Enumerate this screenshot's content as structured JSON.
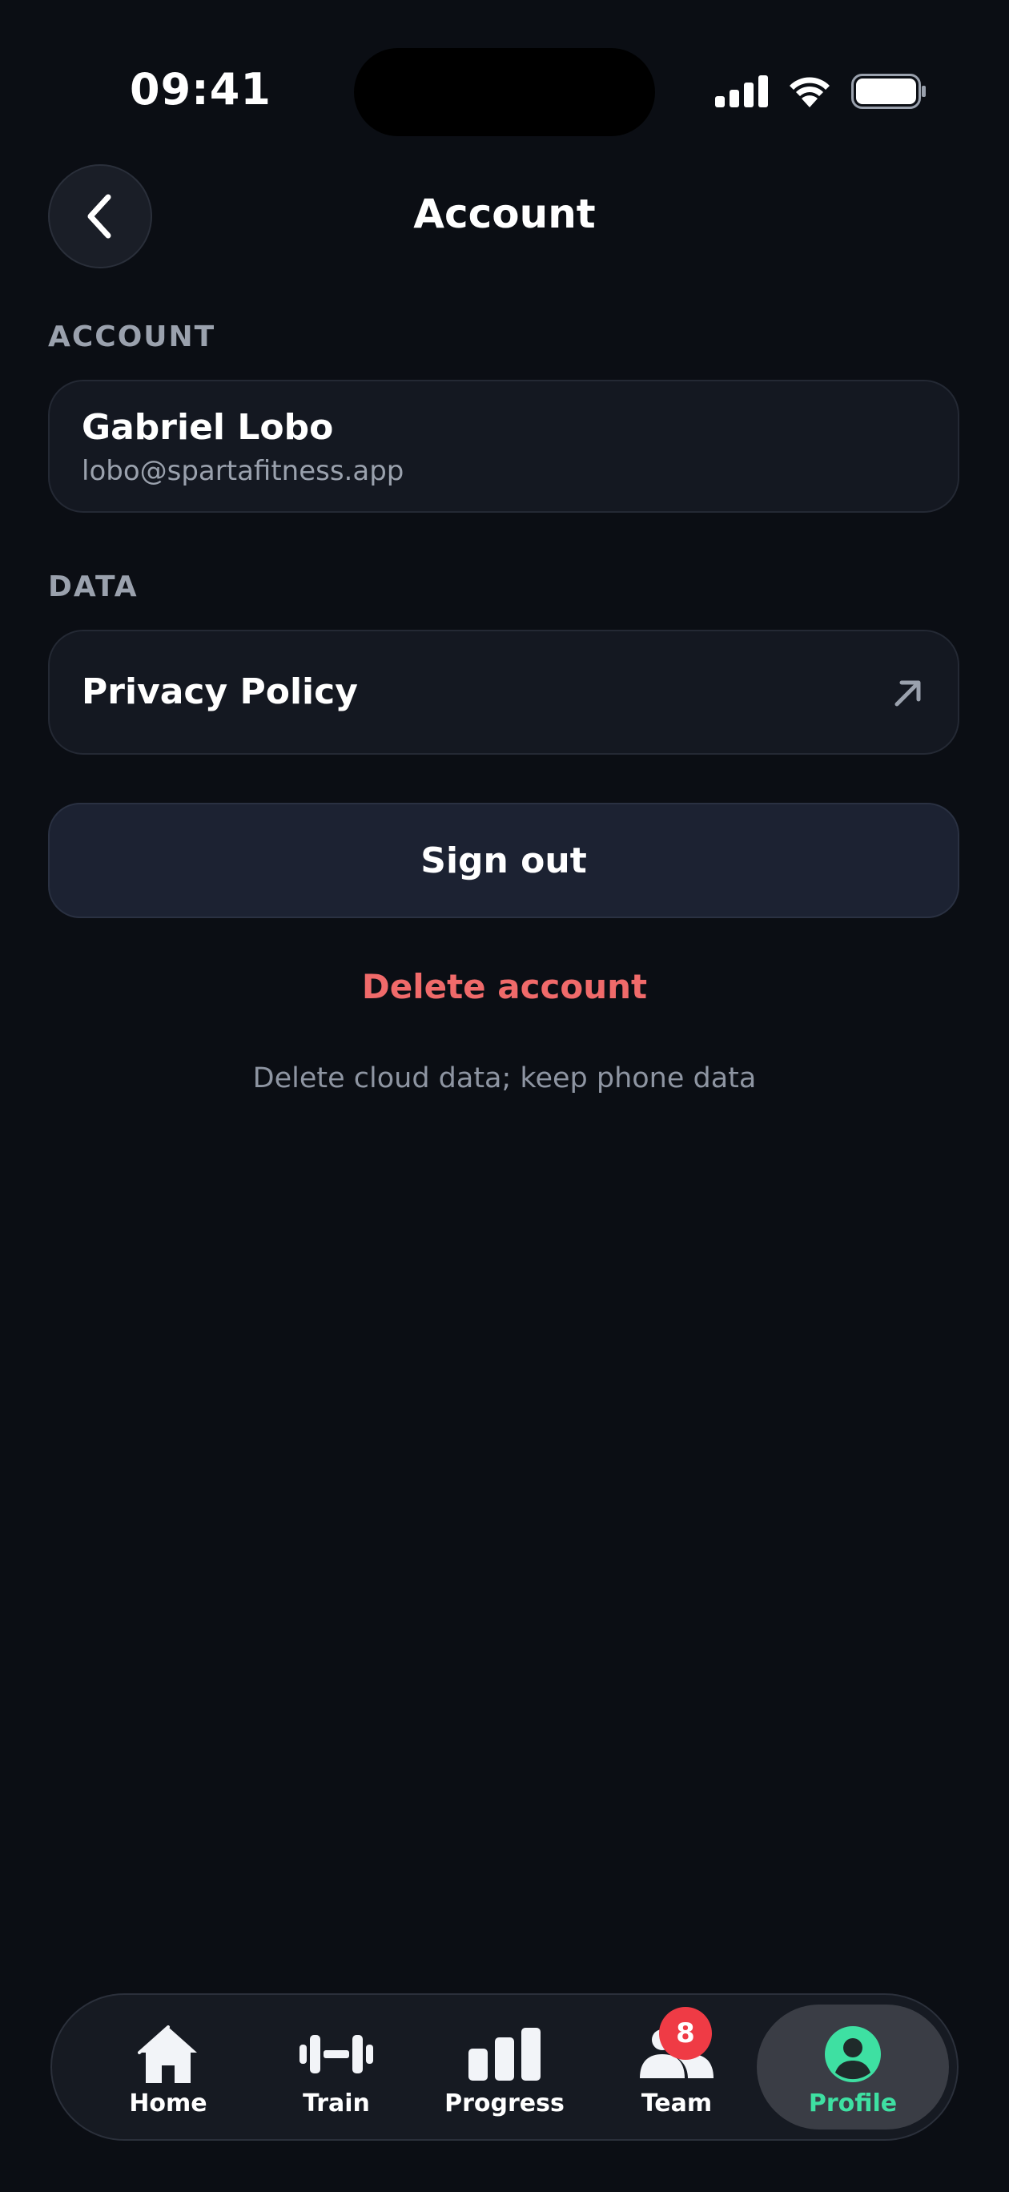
{
  "status_bar": {
    "time": "09:41"
  },
  "header": {
    "title": "Account",
    "back_icon": "chevron-left-icon"
  },
  "account_section": {
    "label": "ACCOUNT",
    "name": "Gabriel Lobo",
    "email": "lobo@spartafitness.app"
  },
  "data_section": {
    "label": "DATA",
    "privacy_policy": "Privacy Policy",
    "external_icon": "arrow-up-right-icon"
  },
  "actions": {
    "sign_out": "Sign out",
    "delete_account": "Delete account",
    "delete_hint": "Delete cloud data; keep phone data"
  },
  "tab_bar": {
    "tabs": [
      {
        "label": "Home",
        "icon": "home-icon"
      },
      {
        "label": "Train",
        "icon": "dumbbell-icon"
      },
      {
        "label": "Progress",
        "icon": "bar-chart-icon"
      },
      {
        "label": "Team",
        "icon": "team-icon"
      },
      {
        "label": "Profile",
        "icon": "profile-icon"
      }
    ],
    "active": "Profile",
    "team_badge": "8"
  },
  "colors": {
    "background": "#0b0e14",
    "card": "#141821",
    "accent_green": "#3ee0a2",
    "danger": "#f06a6a",
    "badge": "#ef3b45"
  }
}
